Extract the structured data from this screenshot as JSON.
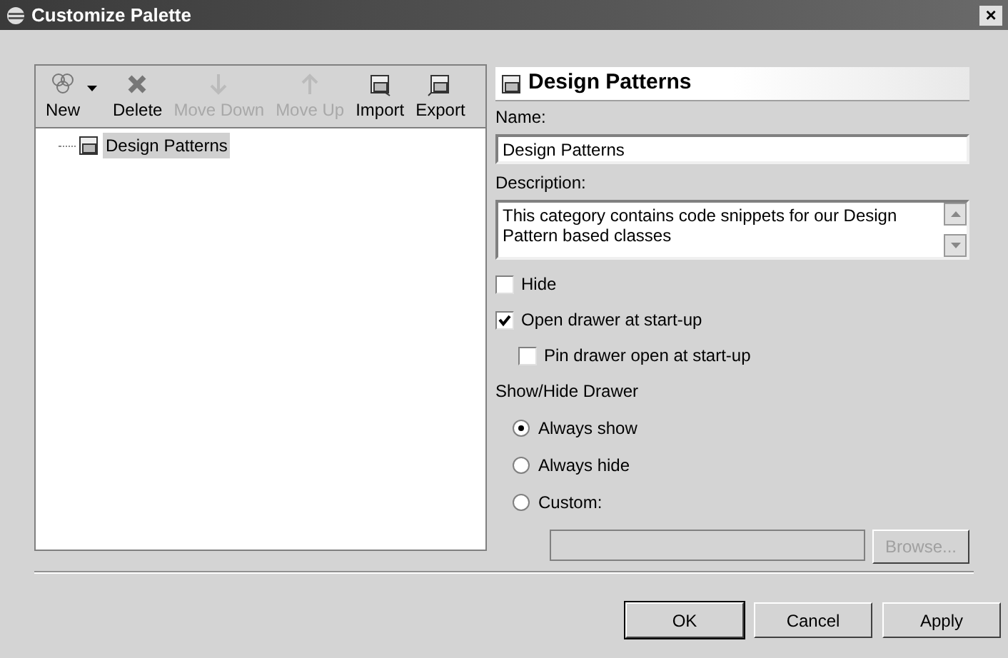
{
  "window": {
    "title": "Customize Palette",
    "close": "×"
  },
  "toolbar": [
    {
      "label": "New",
      "kind": "new",
      "disabled": false,
      "dropdown": true
    },
    {
      "label": "Delete",
      "kind": "delete",
      "disabled": false
    },
    {
      "label": "Move Down",
      "kind": "down",
      "disabled": true
    },
    {
      "label": "Move Up",
      "kind": "up",
      "disabled": true
    },
    {
      "label": "Import",
      "kind": "import",
      "disabled": false
    },
    {
      "label": "Export",
      "kind": "export",
      "disabled": false
    }
  ],
  "tree": [
    {
      "label": "Design Patterns",
      "selected": true
    }
  ],
  "details": {
    "title": "Design Patterns",
    "name_label": "Name:",
    "name_value": "Design Patterns",
    "description_label": "Description:",
    "description_value": "This category contains code snippets for our Design Pattern based classes",
    "checkboxes": [
      {
        "label": "Hide",
        "checked": false,
        "indent": false
      },
      {
        "label": "Open drawer at start-up",
        "checked": true,
        "indent": false
      },
      {
        "label": "Pin drawer open at start-up",
        "checked": false,
        "indent": true
      }
    ],
    "group_label": "Show/Hide Drawer",
    "radios": [
      {
        "label": "Always show",
        "selected": true
      },
      {
        "label": "Always hide",
        "selected": false
      },
      {
        "label": "Custom:",
        "selected": false
      }
    ],
    "custom_field": {
      "disabled": true
    },
    "browse": {
      "label": "Browse...",
      "disabled": true
    }
  },
  "buttons": [
    {
      "label": "OK",
      "default": true
    },
    {
      "label": "Cancel",
      "default": false
    },
    {
      "label": "Apply",
      "default": false
    }
  ]
}
